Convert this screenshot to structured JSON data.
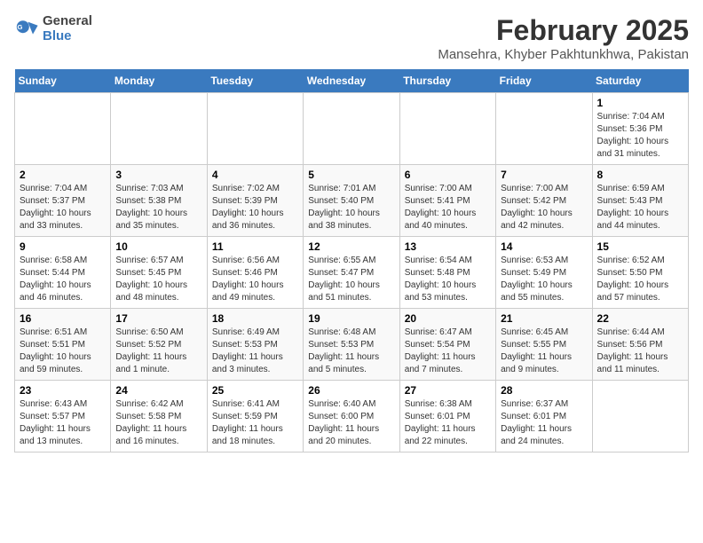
{
  "logo": {
    "general": "General",
    "blue": "Blue"
  },
  "title": "February 2025",
  "subtitle": "Mansehra, Khyber Pakhtunkhwa, Pakistan",
  "headers": [
    "Sunday",
    "Monday",
    "Tuesday",
    "Wednesday",
    "Thursday",
    "Friday",
    "Saturday"
  ],
  "weeks": [
    [
      {
        "day": "",
        "content": ""
      },
      {
        "day": "",
        "content": ""
      },
      {
        "day": "",
        "content": ""
      },
      {
        "day": "",
        "content": ""
      },
      {
        "day": "",
        "content": ""
      },
      {
        "day": "",
        "content": ""
      },
      {
        "day": "1",
        "content": "Sunrise: 7:04 AM\nSunset: 5:36 PM\nDaylight: 10 hours\nand 31 minutes."
      }
    ],
    [
      {
        "day": "2",
        "content": "Sunrise: 7:04 AM\nSunset: 5:37 PM\nDaylight: 10 hours\nand 33 minutes."
      },
      {
        "day": "3",
        "content": "Sunrise: 7:03 AM\nSunset: 5:38 PM\nDaylight: 10 hours\nand 35 minutes."
      },
      {
        "day": "4",
        "content": "Sunrise: 7:02 AM\nSunset: 5:39 PM\nDaylight: 10 hours\nand 36 minutes."
      },
      {
        "day": "5",
        "content": "Sunrise: 7:01 AM\nSunset: 5:40 PM\nDaylight: 10 hours\nand 38 minutes."
      },
      {
        "day": "6",
        "content": "Sunrise: 7:00 AM\nSunset: 5:41 PM\nDaylight: 10 hours\nand 40 minutes."
      },
      {
        "day": "7",
        "content": "Sunrise: 7:00 AM\nSunset: 5:42 PM\nDaylight: 10 hours\nand 42 minutes."
      },
      {
        "day": "8",
        "content": "Sunrise: 6:59 AM\nSunset: 5:43 PM\nDaylight: 10 hours\nand 44 minutes."
      }
    ],
    [
      {
        "day": "9",
        "content": "Sunrise: 6:58 AM\nSunset: 5:44 PM\nDaylight: 10 hours\nand 46 minutes."
      },
      {
        "day": "10",
        "content": "Sunrise: 6:57 AM\nSunset: 5:45 PM\nDaylight: 10 hours\nand 48 minutes."
      },
      {
        "day": "11",
        "content": "Sunrise: 6:56 AM\nSunset: 5:46 PM\nDaylight: 10 hours\nand 49 minutes."
      },
      {
        "day": "12",
        "content": "Sunrise: 6:55 AM\nSunset: 5:47 PM\nDaylight: 10 hours\nand 51 minutes."
      },
      {
        "day": "13",
        "content": "Sunrise: 6:54 AM\nSunset: 5:48 PM\nDaylight: 10 hours\nand 53 minutes."
      },
      {
        "day": "14",
        "content": "Sunrise: 6:53 AM\nSunset: 5:49 PM\nDaylight: 10 hours\nand 55 minutes."
      },
      {
        "day": "15",
        "content": "Sunrise: 6:52 AM\nSunset: 5:50 PM\nDaylight: 10 hours\nand 57 minutes."
      }
    ],
    [
      {
        "day": "16",
        "content": "Sunrise: 6:51 AM\nSunset: 5:51 PM\nDaylight: 10 hours\nand 59 minutes."
      },
      {
        "day": "17",
        "content": "Sunrise: 6:50 AM\nSunset: 5:52 PM\nDaylight: 11 hours\nand 1 minute."
      },
      {
        "day": "18",
        "content": "Sunrise: 6:49 AM\nSunset: 5:53 PM\nDaylight: 11 hours\nand 3 minutes."
      },
      {
        "day": "19",
        "content": "Sunrise: 6:48 AM\nSunset: 5:53 PM\nDaylight: 11 hours\nand 5 minutes."
      },
      {
        "day": "20",
        "content": "Sunrise: 6:47 AM\nSunset: 5:54 PM\nDaylight: 11 hours\nand 7 minutes."
      },
      {
        "day": "21",
        "content": "Sunrise: 6:45 AM\nSunset: 5:55 PM\nDaylight: 11 hours\nand 9 minutes."
      },
      {
        "day": "22",
        "content": "Sunrise: 6:44 AM\nSunset: 5:56 PM\nDaylight: 11 hours\nand 11 minutes."
      }
    ],
    [
      {
        "day": "23",
        "content": "Sunrise: 6:43 AM\nSunset: 5:57 PM\nDaylight: 11 hours\nand 13 minutes."
      },
      {
        "day": "24",
        "content": "Sunrise: 6:42 AM\nSunset: 5:58 PM\nDaylight: 11 hours\nand 16 minutes."
      },
      {
        "day": "25",
        "content": "Sunrise: 6:41 AM\nSunset: 5:59 PM\nDaylight: 11 hours\nand 18 minutes."
      },
      {
        "day": "26",
        "content": "Sunrise: 6:40 AM\nSunset: 6:00 PM\nDaylight: 11 hours\nand 20 minutes."
      },
      {
        "day": "27",
        "content": "Sunrise: 6:38 AM\nSunset: 6:01 PM\nDaylight: 11 hours\nand 22 minutes."
      },
      {
        "day": "28",
        "content": "Sunrise: 6:37 AM\nSunset: 6:01 PM\nDaylight: 11 hours\nand 24 minutes."
      },
      {
        "day": "",
        "content": ""
      }
    ]
  ]
}
